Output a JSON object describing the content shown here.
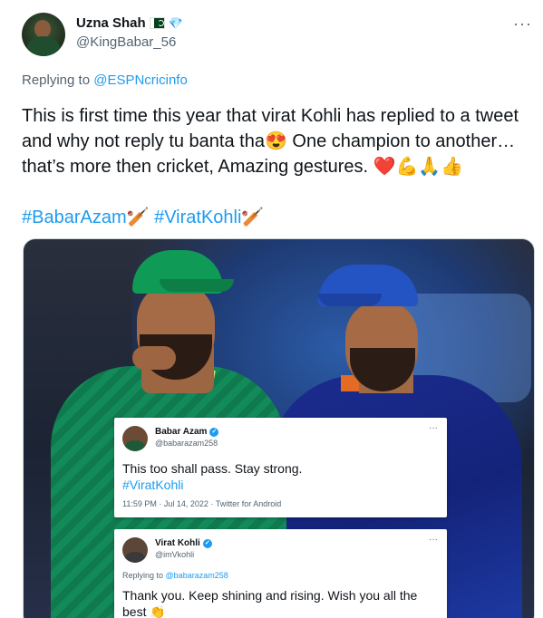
{
  "tweet": {
    "display_name": "Uzna Shah",
    "badge_icon": "💎",
    "flag_icon": "pakistan-flag-icon",
    "handle": "@KingBabar_56",
    "more_label": "···",
    "replying_prefix": "Replying to",
    "replying_mention": "@ESPNcricinfo",
    "text": "This is first time this year that virat Kohli has replied to a tweet and why not reply tu banta tha😍 One champion to another… that’s more then cricket, Amazing gestures. ❤️💪🙏👍",
    "hashtags": "#BabarAzam🏏 #ViratKohli🏏"
  },
  "media": {
    "card1": {
      "name": "Babar Azam",
      "verified": "✓",
      "handle": "@babarazam258",
      "more": "···",
      "text": "This too shall pass. Stay strong.",
      "hashtag": "#ViratKohli",
      "meta": "11:59 PM · Jul 14, 2022 · Twitter for Android"
    },
    "card2": {
      "name": "Virat Kohli",
      "verified": "✓",
      "handle": "@imVkohli",
      "more": "···",
      "replying_prefix": "Replying to",
      "replying_mention": "@babarazam258",
      "text": "Thank you. Keep shining and rising. Wish you all the best 👏"
    }
  },
  "colors": {
    "link": "#1d9bf0",
    "secondary_text": "#536471",
    "primary_text": "#0f1419"
  }
}
